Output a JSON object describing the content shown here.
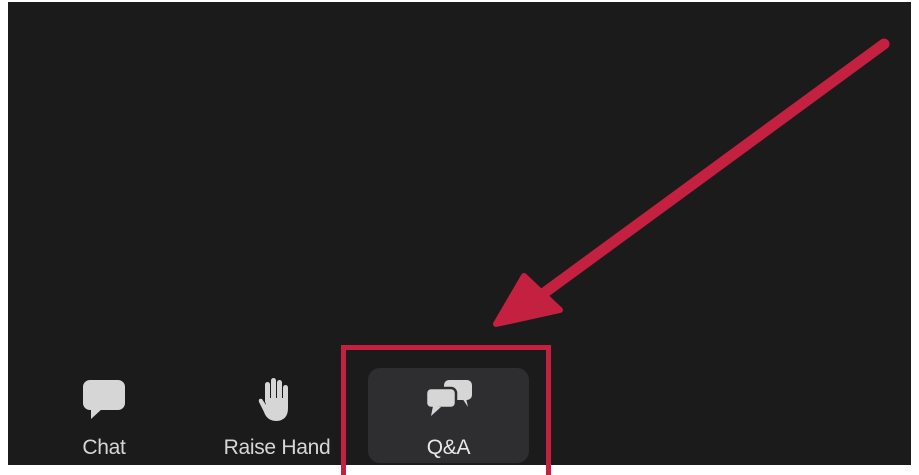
{
  "toolbar": {
    "buttons": [
      {
        "label": "Chat",
        "icon": "chat-bubble-icon"
      },
      {
        "label": "Raise Hand",
        "icon": "raised-hand-icon"
      },
      {
        "label": "Q&A",
        "icon": "qa-bubbles-icon",
        "active": true
      }
    ]
  },
  "annotation": {
    "color": "#c4203f",
    "target": "Q&A"
  },
  "colors": {
    "background": "#1c1b1c",
    "active_button_bg": "#2e2d30",
    "icon_color": "#d6d6d6"
  }
}
